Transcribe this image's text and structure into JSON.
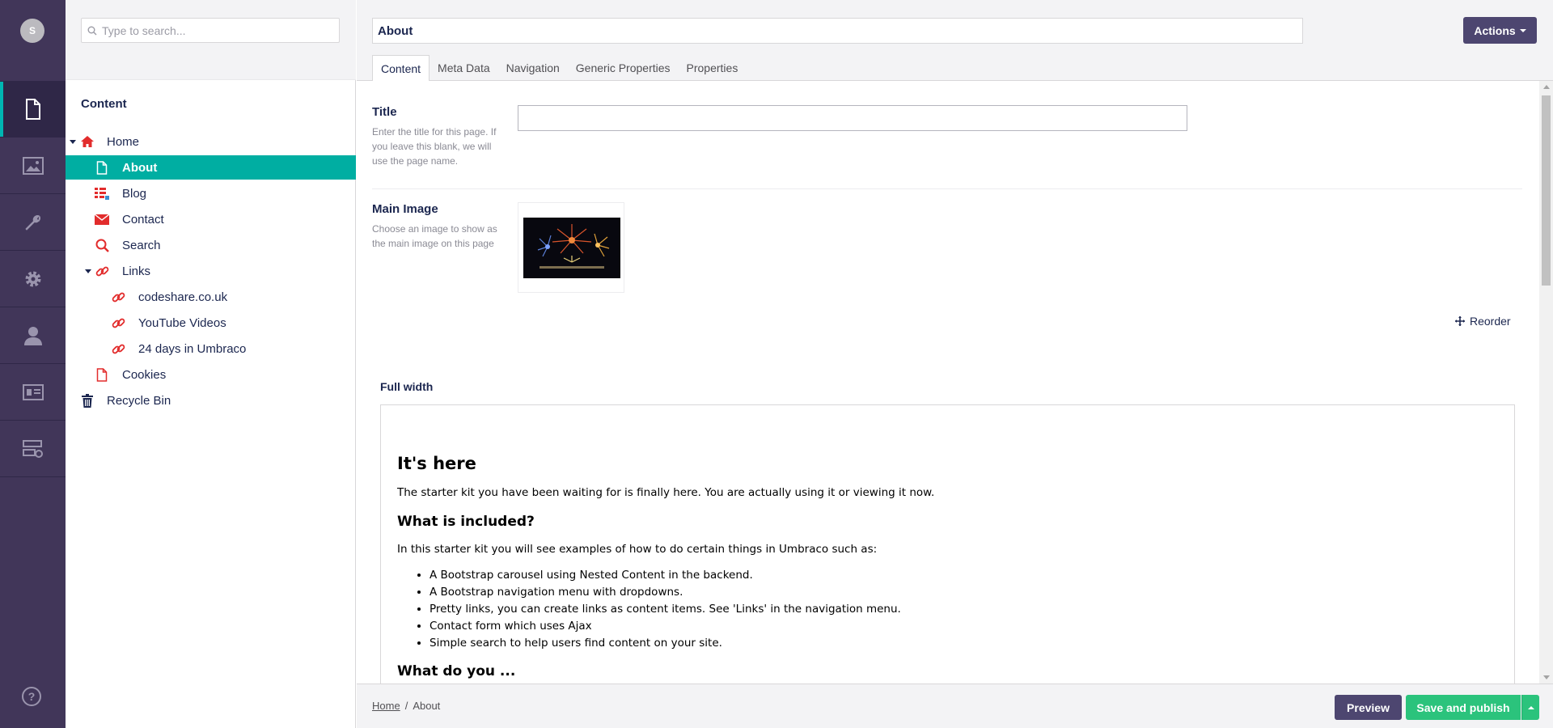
{
  "app": {
    "user_initial": "S",
    "accent": "#00aea2",
    "rail_bg": "#413659",
    "sections": [
      {
        "name": "content",
        "icon": "document-icon",
        "active": true
      },
      {
        "name": "media",
        "icon": "picture-icon",
        "active": false
      },
      {
        "name": "settings",
        "icon": "wrench-icon",
        "active": false
      },
      {
        "name": "packages",
        "icon": "gear-icon",
        "active": false
      },
      {
        "name": "users",
        "icon": "user-icon",
        "active": false
      },
      {
        "name": "members",
        "icon": "id-card-icon",
        "active": false
      },
      {
        "name": "forms",
        "icon": "forms-icon",
        "active": false
      }
    ],
    "help_icon": "help-icon"
  },
  "tree": {
    "search_placeholder": "Type to search...",
    "section_title": "Content",
    "nodes": [
      {
        "label": "Home",
        "icon": "home-icon"
      },
      {
        "label": "About",
        "icon": "document-icon",
        "selected": true
      },
      {
        "label": "Blog",
        "icon": "list-icon"
      },
      {
        "label": "Contact",
        "icon": "envelope-icon"
      },
      {
        "label": "Search",
        "icon": "search-icon"
      },
      {
        "label": "Links",
        "icon": "link-icon"
      },
      {
        "label": "codeshare.co.uk",
        "icon": "link-icon"
      },
      {
        "label": "YouTube Videos",
        "icon": "link-icon"
      },
      {
        "label": "24 days in Umbraco",
        "icon": "link-icon"
      },
      {
        "label": "Cookies",
        "icon": "document-icon"
      },
      {
        "label": "Recycle Bin",
        "icon": "trash-icon"
      }
    ]
  },
  "header": {
    "name_value": "About",
    "actions_label": "Actions",
    "tabs": [
      "Content",
      "Meta Data",
      "Navigation",
      "Generic Properties",
      "Properties"
    ],
    "active_tab": "Content"
  },
  "editor": {
    "title_label": "Title",
    "title_desc": "Enter the title for this page. If you leave this blank, we will use the page name.",
    "title_value": "",
    "image_label": "Main Image",
    "image_desc": "Choose an image to show as the main image on this page",
    "reorder_label": "Reorder",
    "fullwidth_label": "Full width",
    "rte": {
      "h1": "It's here",
      "p1": "The starter kit you have been waiting for is finally here. You are actually using it or viewing it now.",
      "h2": "What is included?",
      "p2": "In this starter kit you will see examples of how to do certain things in Umbraco such as:",
      "items": [
        "A Bootstrap carousel using Nested Content in the backend.",
        "A Bootstrap navigation menu with dropdowns.",
        "Pretty links, you can create links as content items. See 'Links' in the navigation menu.",
        "Contact form which uses Ajax",
        "Simple search to help users find content on your site."
      ],
      "h3_partial": "What do you ..."
    }
  },
  "footer": {
    "breadcrumb": [
      "Home",
      "About"
    ],
    "breadcrumb_sep": "/",
    "preview_label": "Preview",
    "publish_label": "Save and publish"
  }
}
